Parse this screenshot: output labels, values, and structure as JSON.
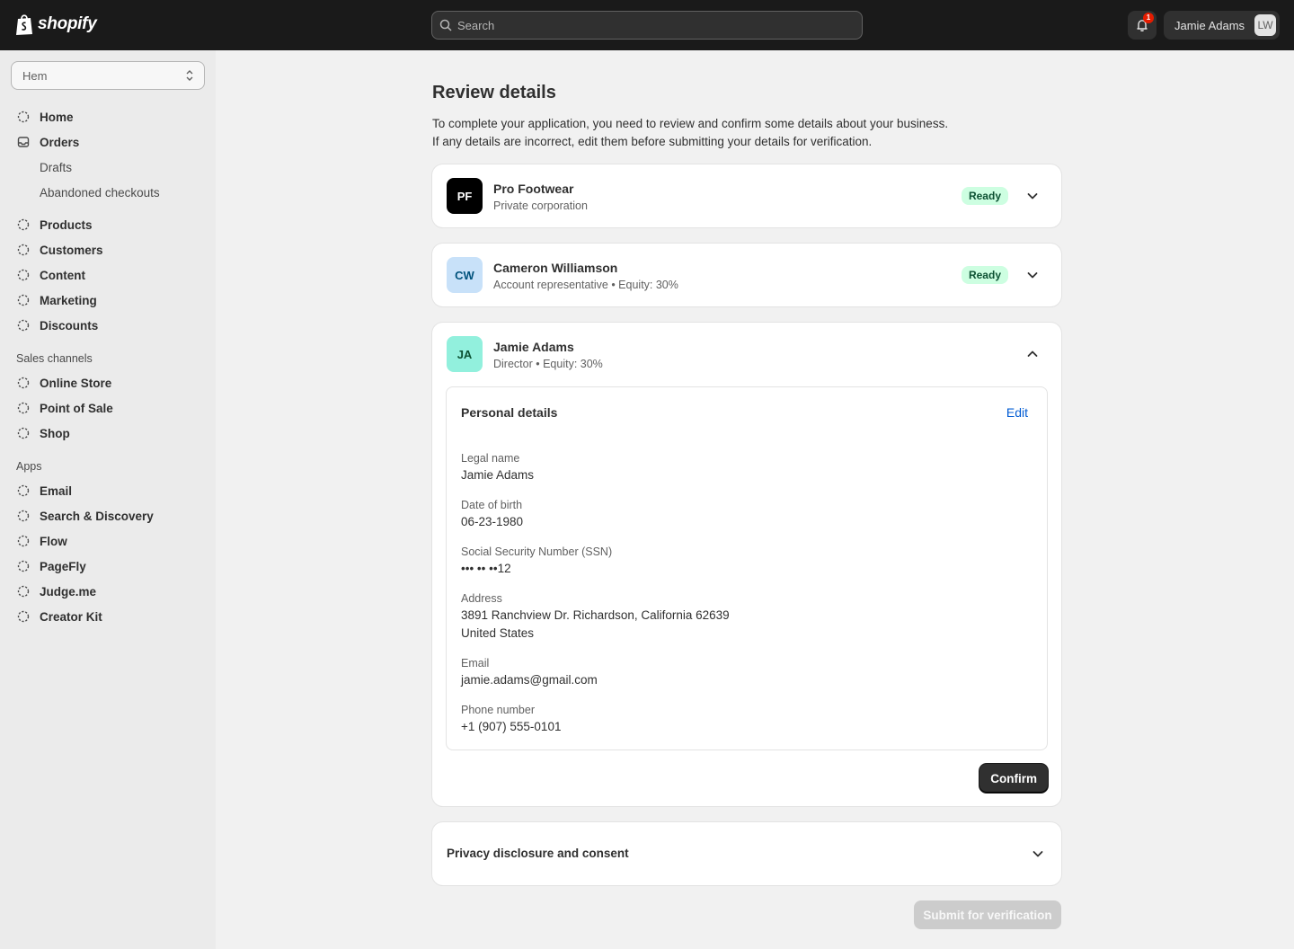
{
  "topbar": {
    "brand": "shopify",
    "search_placeholder": "Search",
    "notification_count": "1",
    "user_name": "Jamie Adams",
    "user_initials": "LW"
  },
  "sidebar": {
    "store_name": "Hem",
    "nav": [
      "Home",
      "Orders",
      "Drafts",
      "Abandoned checkouts",
      "Products",
      "Customers",
      "Content",
      "Marketing",
      "Discounts"
    ],
    "sales_channels_label": "Sales channels",
    "sales_channels": [
      "Online Store",
      "Point of Sale",
      "Shop"
    ],
    "apps_label": "Apps",
    "apps": [
      "Email",
      "Search & Discovery",
      "Flow",
      "PageFly",
      "Judge.me",
      "Creator Kit"
    ]
  },
  "main": {
    "title": "Review details",
    "intro_line1": "To complete your application, you need to review and confirm some details about your business.",
    "intro_line2": "If any details are incorrect, edit them before submitting your details for verification.",
    "cards": [
      {
        "initials": "PF",
        "name": "Pro Footwear",
        "subtitle": "Private corporation",
        "status": "Ready"
      },
      {
        "initials": "CW",
        "name": "Cameron Williamson",
        "subtitle": "Account representative • Equity: 30%",
        "status": "Ready"
      },
      {
        "initials": "JA",
        "name": "Jamie Adams",
        "subtitle": "Director • Equity: 30%"
      }
    ],
    "personal_details": {
      "title": "Personal details",
      "edit_label": "Edit",
      "legal_name_label": "Legal name",
      "legal_name": "Jamie Adams",
      "dob_label": "Date of birth",
      "dob": "06-23-1980",
      "ssn_label": "Social Security Number (SSN)",
      "ssn": "••• •• ••12",
      "address_label": "Address",
      "address_line1": "3891 Ranchview Dr. Richardson, California 62639",
      "address_line2": "United States",
      "email_label": "Email",
      "email": "jamie.adams@gmail.com",
      "phone_label": "Phone number",
      "phone": "+1 (907) 555-0101"
    },
    "confirm_label": "Confirm",
    "privacy_title": "Privacy disclosure and consent",
    "submit_label": "Submit for verification"
  },
  "colors": {
    "topbar_bg": "#1a1a1a",
    "ready_badge_bg": "#cdfee1",
    "link": "#005bd3",
    "avatar_pf": "#000000",
    "avatar_cw": "#c8e1f9",
    "avatar_ja": "#92f0dd"
  }
}
